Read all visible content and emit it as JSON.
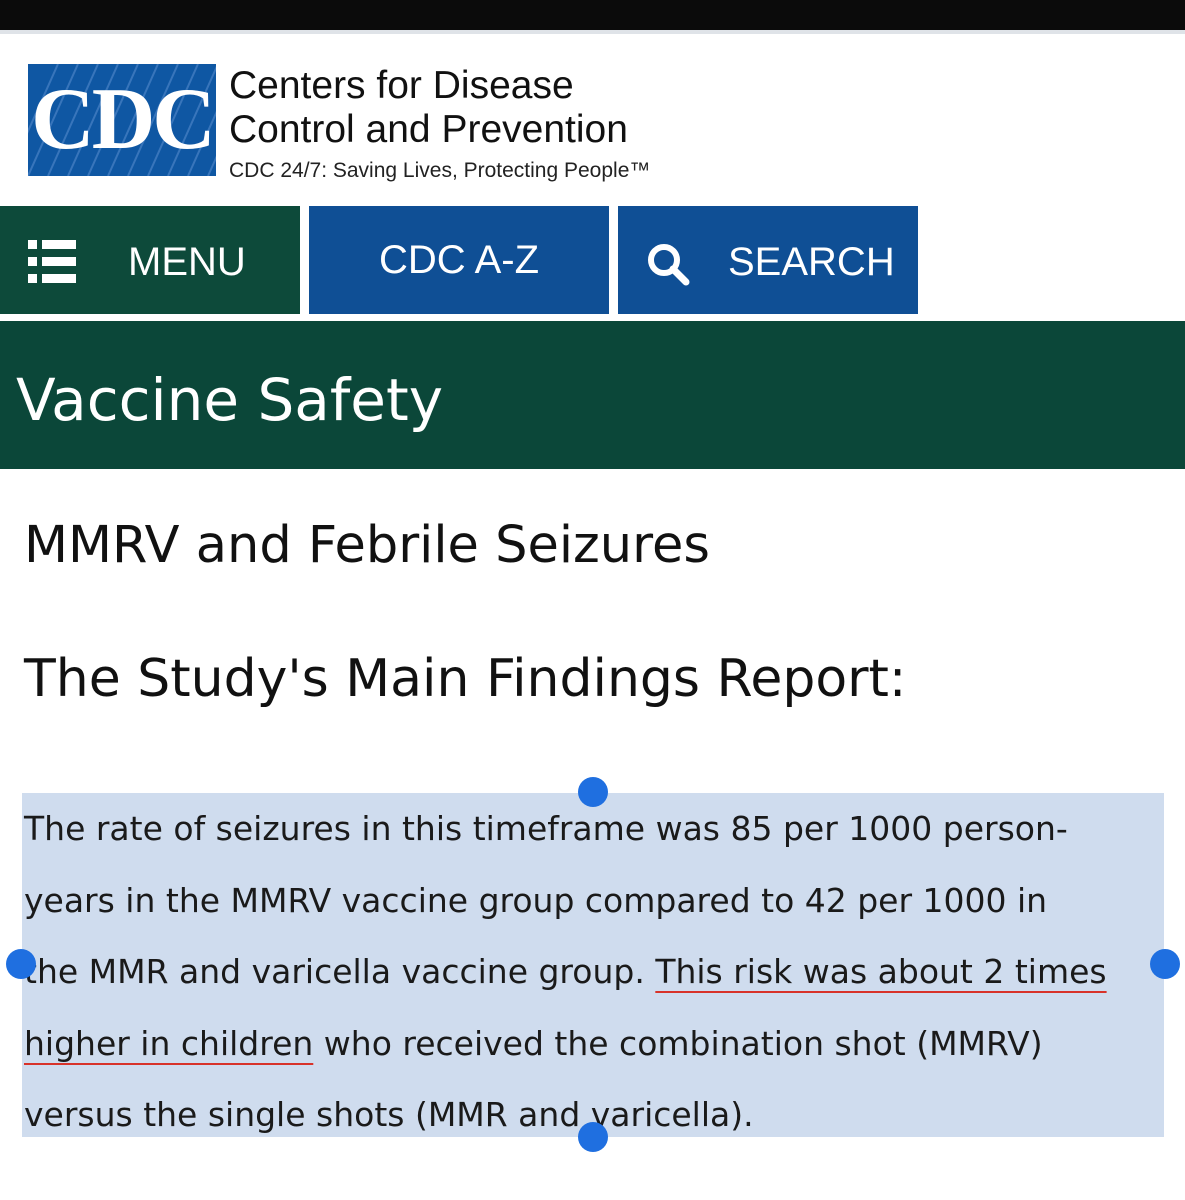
{
  "logo": {
    "letters": "CDC",
    "org_line1": "Centers for Disease",
    "org_line2": "Control and Prevention",
    "tagline": "CDC 24/7: Saving Lives, Protecting People™"
  },
  "nav": {
    "menu_label": "MENU",
    "az_label": "CDC A-Z",
    "search_label": "SEARCH"
  },
  "banner": {
    "title": "Vaccine Safety"
  },
  "main": {
    "page_title": "MMRV and Febrile Seizures",
    "section_title": "The Study's Main Findings Report:",
    "paragraph": {
      "line1": "The rate of seizures in this timeframe was 85 per 1000 person-",
      "line2": "years in the MMRV vaccine group compared to 42 per 1000 in",
      "line3_plain": "the MMR and varicella vaccine group. ",
      "line3_underlined": "This risk was about 2 times",
      "line4_underlined": "higher in children",
      "line4_plain": " who received the combination shot (MMRV)",
      "line5": "versus the single shots (MMR and varicella)."
    }
  },
  "colors": {
    "nav_green": "#0d4a3a",
    "nav_blue": "#0f4f95",
    "banner_green": "#0b4739",
    "selection": "#cfdcee",
    "handle": "#1f6fe0",
    "underline": "#d8332a"
  },
  "icons": {
    "menu": "list-menu-icon",
    "search": "search-icon"
  }
}
